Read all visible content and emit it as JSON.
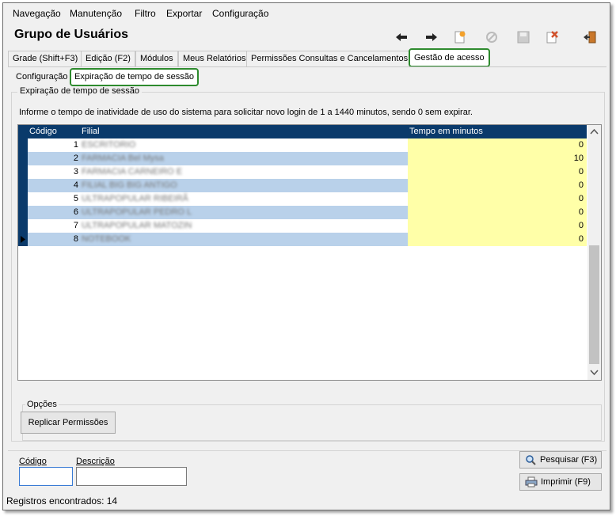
{
  "menu": [
    "Navegação",
    "Manutenção",
    "Filtro",
    "Exportar",
    "Configuração"
  ],
  "header": {
    "title": "Grupo de Usuários"
  },
  "tabs": [
    "Grade (Shift+F3)",
    "Edição (F2)",
    "Módulos",
    "Meus Relatórios",
    "Permissões Consultas e Cancelamentos",
    "Gestão de acesso"
  ],
  "subtabs": [
    "Configuração",
    "Expiração de tempo de sessão"
  ],
  "group": {
    "title": "Expiração de tempo de sessão",
    "info": "Informe o tempo de inatividade de uso do sistema para solicitar novo login de 1 a 1440 minutos, sendo 0 sem expirar."
  },
  "grid": {
    "columns": [
      "Código",
      "Filial",
      "Tempo em minutos"
    ],
    "rows": [
      {
        "codigo": "1",
        "filial": "ESCRITORIO",
        "tempo": "0"
      },
      {
        "codigo": "2",
        "filial": "FARMACIA Bel Mysa",
        "tempo": "10"
      },
      {
        "codigo": "3",
        "filial": "FARMACIA CARNEIRO E",
        "tempo": "0"
      },
      {
        "codigo": "4",
        "filial": "FILIAL BIG BIG ANTIGO",
        "tempo": "0"
      },
      {
        "codigo": "5",
        "filial": "ULTRAPOPULAR RIBEIRÃ",
        "tempo": "0"
      },
      {
        "codigo": "6",
        "filial": "ULTRAPOPULAR PEDRO L",
        "tempo": "0"
      },
      {
        "codigo": "7",
        "filial": "ULTRAPOPULAR MATOZIN",
        "tempo": "0"
      },
      {
        "codigo": "8",
        "filial": "NOTEBOOK",
        "tempo": "0"
      }
    ]
  },
  "opcoes": {
    "title": "Opções",
    "replicar": "Replicar Permissões"
  },
  "search": {
    "codigo_label": "Código",
    "descricao_label": "Descrição",
    "codigo_value": "",
    "descricao_value": "",
    "pesquisar": "Pesquisar (F3)",
    "imprimir": "Imprimir (F9)"
  },
  "status": "Registros encontrados: 14",
  "colors": {
    "header_bg": "#0a3a6b",
    "row_alt": "#b9d1ea",
    "tempo_cell": "#ffffa8",
    "active_tab_border": "#2e8b2e"
  }
}
